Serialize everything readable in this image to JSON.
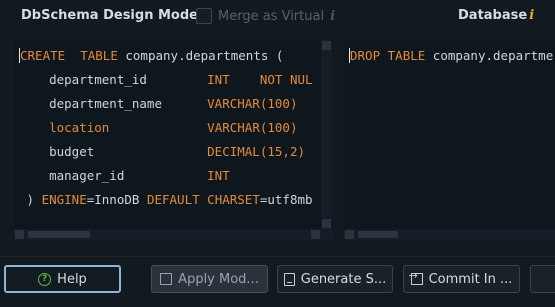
{
  "header": {
    "title": "DbSchema Design Model",
    "title_info_icon": "info-icon",
    "merge_label": "Merge as Virtual",
    "merge_checked": false,
    "database_title": "Database"
  },
  "left_editor": {
    "lines": [
      {
        "segments": [
          {
            "t": "CREATE",
            "kw": true
          },
          {
            "t": "  ",
            "kw": false
          },
          {
            "t": "TABLE",
            "kw": true
          },
          {
            "t": " company.departments (",
            "kw": false
          }
        ]
      },
      {
        "segments": [
          {
            "t": "    department_id        ",
            "kw": false
          },
          {
            "t": "INT",
            "kw": true
          },
          {
            "t": "    ",
            "kw": false
          },
          {
            "t": "NOT NUL",
            "kw": true
          }
        ]
      },
      {
        "segments": [
          {
            "t": "    department_name      ",
            "kw": false
          },
          {
            "t": "VARCHAR(100)",
            "kw": true
          }
        ]
      },
      {
        "segments": [
          {
            "t": "    ",
            "kw": false
          },
          {
            "t": "location",
            "kw": true
          },
          {
            "t": "             ",
            "kw": false
          },
          {
            "t": "VARCHAR(100)",
            "kw": true
          }
        ]
      },
      {
        "segments": [
          {
            "t": "    budget               ",
            "kw": false
          },
          {
            "t": "DECIMAL(15,2)",
            "kw": true
          }
        ]
      },
      {
        "segments": [
          {
            "t": "    manager_id           ",
            "kw": false
          },
          {
            "t": "INT",
            "kw": true
          }
        ]
      },
      {
        "segments": [
          {
            "t": " ) ",
            "kw": false
          },
          {
            "t": "ENGINE",
            "kw": true
          },
          {
            "t": "=InnoDB ",
            "kw": false
          },
          {
            "t": "DEFAULT",
            "kw": true
          },
          {
            "t": " ",
            "kw": false
          },
          {
            "t": "CHARSET",
            "kw": true
          },
          {
            "t": "=utf8mb",
            "kw": false
          }
        ]
      }
    ]
  },
  "right_editor": {
    "lines": [
      {
        "segments": [
          {
            "t": "DROP",
            "kw": true
          },
          {
            "t": " ",
            "kw": false
          },
          {
            "t": "TABLE",
            "kw": true
          },
          {
            "t": " company.departme",
            "kw": false
          }
        ]
      }
    ]
  },
  "toolbar": {
    "help_label": "Help",
    "apply_label": "Apply Mod...",
    "generate_label": "Generate S...",
    "commit_label": "Commit In ..."
  },
  "colors": {
    "keyword": "#e3893a",
    "text": "#cfd6dd",
    "background": "#12191f",
    "info_accent": "#e0a82e",
    "help_focus_border": "#8fb4d6"
  }
}
